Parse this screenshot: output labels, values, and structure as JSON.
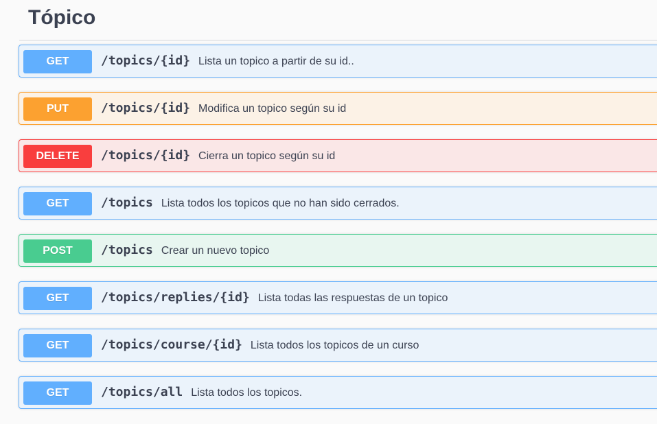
{
  "section": {
    "title": "Tópico"
  },
  "operations": [
    {
      "method": "GET",
      "path": "/topics/{id}",
      "summary": "Lista un topico a partir de su id.."
    },
    {
      "method": "PUT",
      "path": "/topics/{id}",
      "summary": "Modifica un topico según su id"
    },
    {
      "method": "DELETE",
      "path": "/topics/{id}",
      "summary": "Cierra un topico según su id"
    },
    {
      "method": "GET",
      "path": "/topics",
      "summary": "Lista todos los topicos que no han sido cerrados."
    },
    {
      "method": "POST",
      "path": "/topics",
      "summary": "Crear un nuevo topico"
    },
    {
      "method": "GET",
      "path": "/topics/replies/{id}",
      "summary": "Lista todas las respuestas de un topico"
    },
    {
      "method": "GET",
      "path": "/topics/course/{id}",
      "summary": "Lista todos los topicos de un curso"
    },
    {
      "method": "GET",
      "path": "/topics/all",
      "summary": "Lista todos los topicos."
    }
  ],
  "colors": {
    "get": "#61affe",
    "put": "#fca130",
    "delete": "#f93e3e",
    "post": "#49cc90",
    "text": "#3b4151"
  }
}
